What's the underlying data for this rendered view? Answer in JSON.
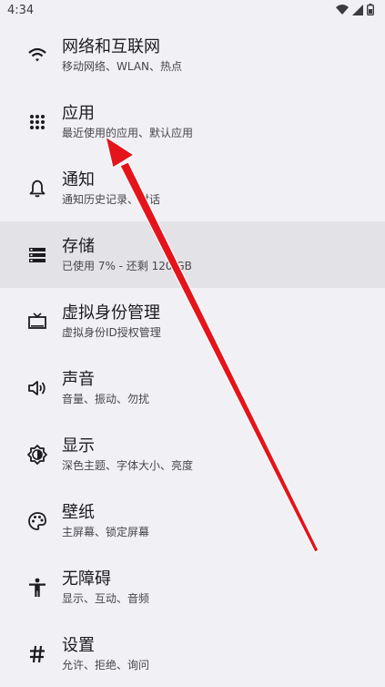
{
  "status": {
    "time": "4:34"
  },
  "items": [
    {
      "title": "网络和互联网",
      "subtitle": "移动网络、WLAN、热点",
      "icon": "wifi-icon"
    },
    {
      "title": "应用",
      "subtitle": "最近使用的应用、默认应用",
      "icon": "apps-grid-icon"
    },
    {
      "title": "通知",
      "subtitle": "通知历史记录、对话",
      "icon": "bell-icon"
    },
    {
      "title": "存储",
      "subtitle": "已使用 7% - 还剩 120 GB",
      "icon": "storage-icon"
    },
    {
      "title": "虚拟身份管理",
      "subtitle": "虚拟身份ID授权管理",
      "icon": "tv-icon"
    },
    {
      "title": "声音",
      "subtitle": "音量、振动、勿扰",
      "icon": "volume-icon"
    },
    {
      "title": "显示",
      "subtitle": "深色主题、字体大小、亮度",
      "icon": "brightness-icon"
    },
    {
      "title": "壁纸",
      "subtitle": "主屏幕、锁定屏幕",
      "icon": "palette-icon"
    },
    {
      "title": "无障碍",
      "subtitle": "显示、互动、音频",
      "icon": "accessibility-icon"
    },
    {
      "title": "设置",
      "subtitle": "允许、拒绝、询问",
      "icon": "hash-icon"
    }
  ],
  "colors": {
    "background": "#f1f0f5",
    "highlight": "#e3e2e7",
    "arrow": "#e5141b"
  }
}
